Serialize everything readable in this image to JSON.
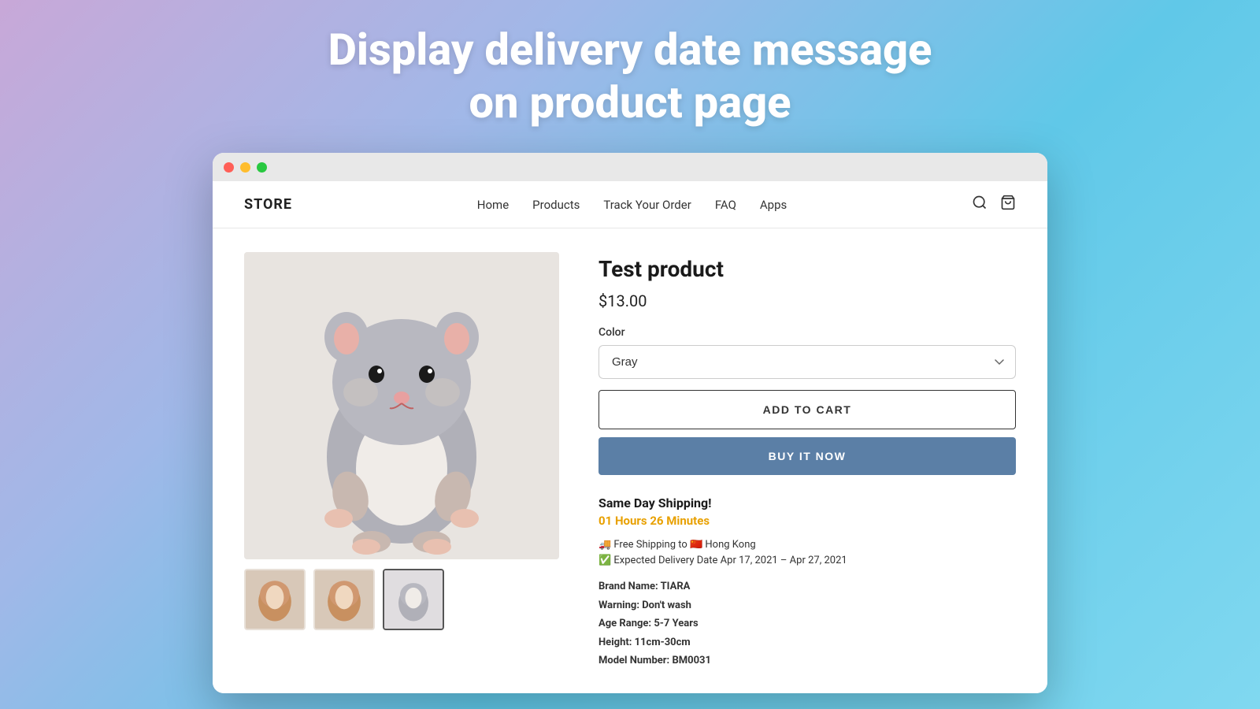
{
  "hero": {
    "title_line1": "Display delivery date message",
    "title_line2": "on product page"
  },
  "browser": {
    "traffic_lights": [
      "red",
      "yellow",
      "green"
    ]
  },
  "nav": {
    "logo": "STORE",
    "links": [
      "Home",
      "Products",
      "Track Your Order",
      "FAQ",
      "Apps"
    ]
  },
  "product": {
    "title": "Test product",
    "price": "$13.00",
    "color_label": "Color",
    "color_value": "Gray",
    "add_to_cart": "ADD TO CART",
    "buy_now": "BUY IT NOW",
    "shipping_heading": "Same Day Shipping!",
    "countdown": "01 Hours 26 Minutes",
    "shipping_line1": "🚚 Free Shipping to 🇨🇳 Hong Kong",
    "delivery_line": "✅ Expected Delivery Date Apr 17, 2021 – Apr 27, 2021",
    "brand": "TIARA",
    "warning": "Don't wash",
    "age_range": "5-7 Years",
    "height": "11cm-30cm",
    "model_number": "BM0031"
  },
  "thumbnails": [
    "🐹",
    "🐹",
    "🐹"
  ]
}
